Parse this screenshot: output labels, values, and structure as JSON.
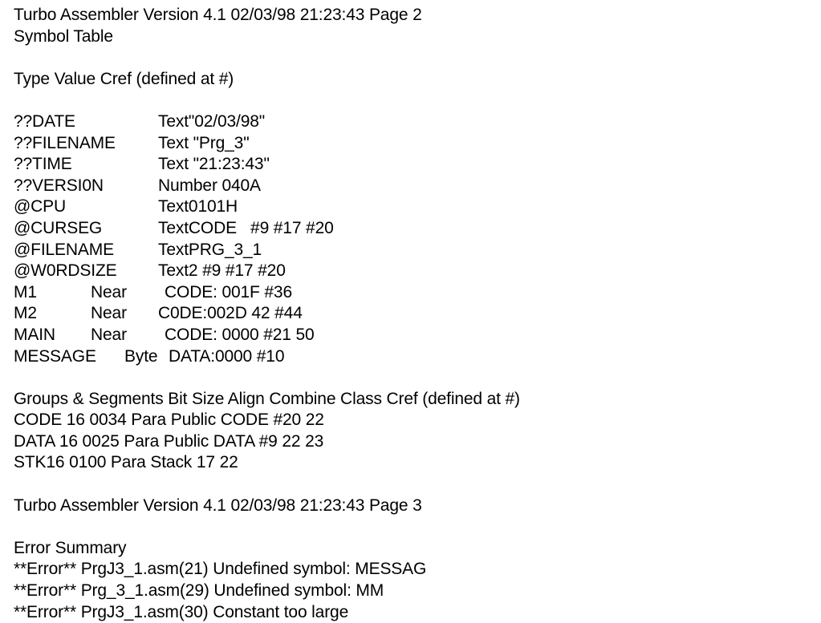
{
  "document": {
    "kind": "assembler-listing",
    "background_color": "#ffffff",
    "text_color": "#000000"
  },
  "page2": {
    "header": "Turbo Assembler Version 4.1 02/03/98 21:23:43 Page 2",
    "section_title": "Symbol Table",
    "column_header": "Type Value Cref (defined at #)",
    "symbols": [
      {
        "name": "??DATE",
        "mid": "",
        "value": "Text\"02/03/98\""
      },
      {
        "name": "??FILENAME",
        "mid": "",
        "value": "Text \"Prg_3\""
      },
      {
        "name": "??TIME",
        "mid": "",
        "value": "Text \"21:23:43\""
      },
      {
        "name": "??VERSI0N",
        "mid": "",
        "value": "Number 040A"
      },
      {
        "name": "@CPU",
        "mid": "",
        "value": "Text0101H"
      },
      {
        "name": "@CURSEG",
        "mid": "",
        "value": "TextCODE   #9 #17 #20"
      },
      {
        "name": "@FILENAME",
        "mid": "",
        "value": "TextPRG_3_1"
      },
      {
        "name": "@W0RDSIZE",
        "mid": "",
        "value": "Text2 #9 #17 #20"
      },
      {
        "name": "M1",
        "mid": "Near",
        "value": "CODE: 001F #36"
      },
      {
        "name": "M2",
        "mid": "Near",
        "value": "C0DE:002D 42 #44"
      },
      {
        "name": "MAIN",
        "mid": "Near",
        "value": "CODE: 0000 #21 50"
      },
      {
        "name": "MESSAGE",
        "mid": "Byte",
        "value": "DATA:0000 #10"
      }
    ],
    "segments_header": "Groups & Segments Bit Size Align Combine Class Cref (defined at #)",
    "segments": [
      "CODE 16 0034 Para Public CODE #20 22",
      "DATA 16 0025 Para Public DATA #9 22 23",
      "STK16 0100 Para Stack 17 22"
    ]
  },
  "page3": {
    "header": "Turbo Assembler Version 4.1 02/03/98 21:23:43 Page 3",
    "section_title": "Error Summary",
    "errors": [
      "**Error** PrgJ3_1.asm(21) Undefined symbol: MESSAG",
      "**Error** Prg_3_1.asm(29) Undefined symbol: MM",
      "**Error** PrgJ3_1.asm(30) Constant too large"
    ]
  }
}
